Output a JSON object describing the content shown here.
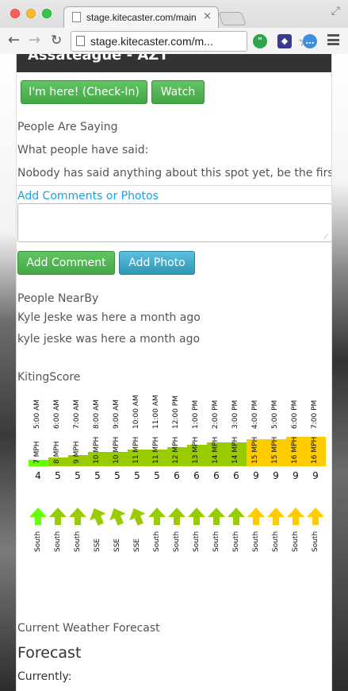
{
  "browser": {
    "tab_title": "stage.kitecaster.com/main",
    "tab_close": "×",
    "url": "stage.kitecaster.com/m...",
    "icons": [
      "fullscreen-icon",
      "back-icon",
      "forward-icon",
      "reload-icon",
      "star-icon",
      "hangouts-icon",
      "hub-icon",
      "chat-icon",
      "menu-icon"
    ]
  },
  "spot": {
    "title": "Assateague - AZT"
  },
  "actions": {
    "checkin_label": "I'm here! (Check-In)",
    "watch_label": "Watch"
  },
  "comments": {
    "heading": "People Are Saying",
    "subheading": "What people have said:",
    "empty": "Nobody has said anything about this spot yet, be the first!",
    "add_link": "Add Comments or Photos",
    "textarea_value": "",
    "add_comment_label": "Add Comment",
    "add_photo_label": "Add Photo"
  },
  "nearby": {
    "heading": "People NearBy",
    "entries": [
      "Kyle Jeske was here a month ago",
      "kyle jeske was here a month ago"
    ]
  },
  "kiting": {
    "heading": "KitingScore",
    "colors": {
      "green": "#99cc00",
      "light_green": "#66ff00",
      "yellow": "#ffcc00"
    }
  },
  "chart_data": {
    "type": "table",
    "times": [
      "5:00 AM",
      "6:00 AM",
      "7:00 AM",
      "8:00 AM",
      "9:00 AM",
      "10:00 AM",
      "11:00 AM",
      "12:00 PM",
      "1:00 PM",
      "2:00 PM",
      "3:00 PM",
      "4:00 PM",
      "5:00 PM",
      "6:00 PM",
      "7:00 PM"
    ],
    "wind_labels": [
      "7 MPH",
      "8 MPH",
      "9 MPH",
      "10 MPH",
      "10 MPH",
      "11 MPH",
      "11 MPH",
      "12 MPH",
      "13 MPH",
      "14 MPH",
      "14 MPH",
      "15 MPH",
      "15 MPH",
      "16 MPH",
      "16 MPH"
    ],
    "wind_mph": [
      7,
      8,
      9,
      10,
      10,
      11,
      11,
      12,
      13,
      14,
      14,
      15,
      15,
      16,
      16
    ],
    "scores": [
      4,
      5,
      5,
      5,
      5,
      5,
      5,
      6,
      6,
      6,
      6,
      9,
      9,
      9,
      9
    ],
    "directions": [
      "South",
      "South",
      "South",
      "SSE",
      "SSE",
      "SSE",
      "South",
      "South",
      "South",
      "South",
      "South",
      "South",
      "South",
      "South",
      "South"
    ],
    "direction_deg": [
      180,
      180,
      180,
      157,
      157,
      157,
      180,
      180,
      180,
      180,
      180,
      180,
      180,
      180,
      180
    ]
  },
  "forecast": {
    "heading": "Current Weather Forecast",
    "title": "Forecast",
    "currently": "Currently:"
  }
}
